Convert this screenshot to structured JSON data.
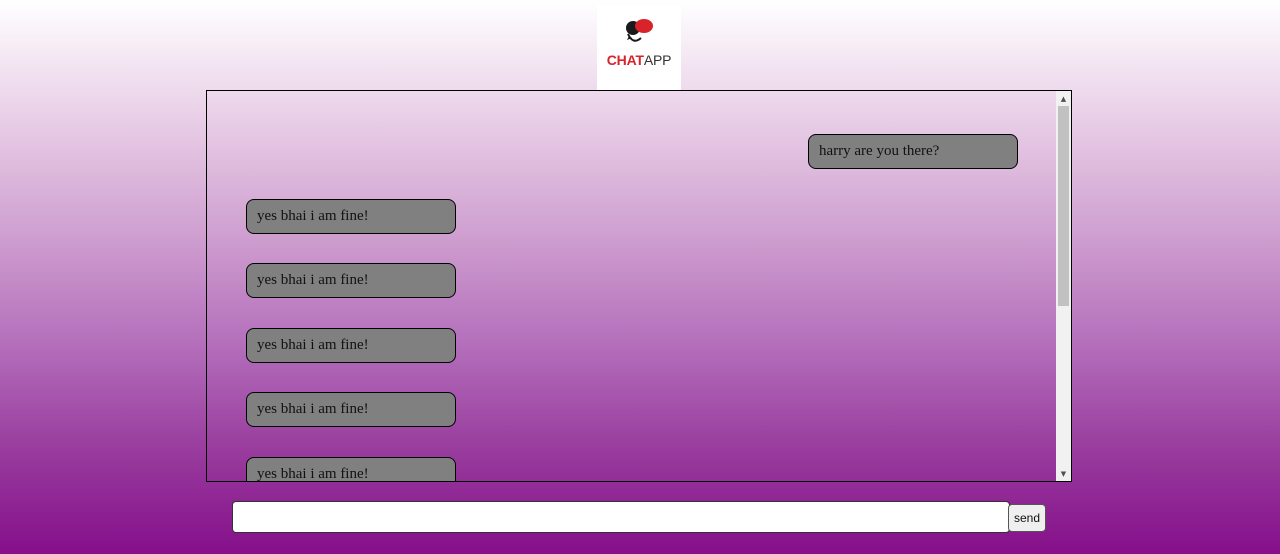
{
  "logo": {
    "brand_bold": "CHAT",
    "brand_light": "APP",
    "colors": {
      "accent": "#d9232a",
      "dark": "#1a1a1a"
    }
  },
  "chat": {
    "messages": [
      {
        "side": "right",
        "text": "harry are you there?"
      },
      {
        "side": "left",
        "text": "yes bhai i am fine!"
      },
      {
        "side": "left",
        "text": "yes bhai i am fine!"
      },
      {
        "side": "left",
        "text": "yes bhai i am fine!"
      },
      {
        "side": "left",
        "text": "yes bhai i am fine!"
      },
      {
        "side": "left",
        "text": "yes bhai i am fine!"
      }
    ]
  },
  "composer": {
    "input_value": "",
    "placeholder": "",
    "send_label": "send"
  }
}
